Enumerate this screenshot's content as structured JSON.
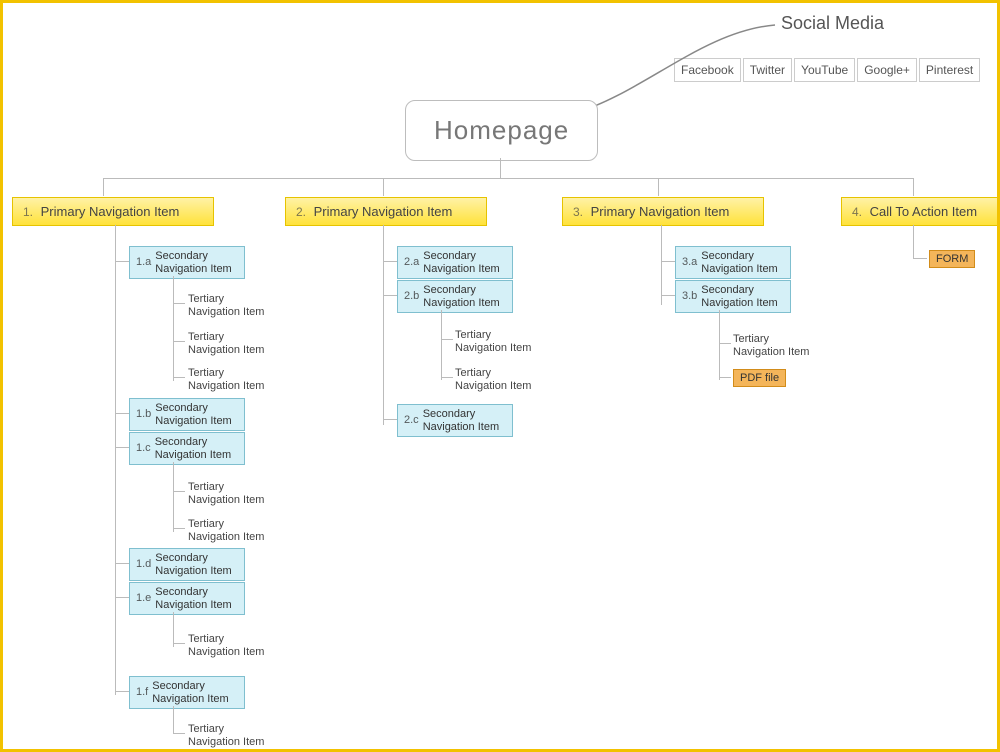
{
  "root": {
    "title": "Homepage"
  },
  "social": {
    "label": "Social Media",
    "items": [
      "Facebook",
      "Twitter",
      "YouTube",
      "Google+",
      "Pinterest"
    ]
  },
  "columns": [
    {
      "num": "1.",
      "label": "Primary Navigation Item",
      "children": [
        {
          "num": "1.a",
          "label": "Secondary\nNavigation Item",
          "children": [
            {
              "label": "Tertiary\nNavigation Item"
            },
            {
              "label": "Tertiary\nNavigation Item"
            },
            {
              "label": "Tertiary\nNavigation Item"
            }
          ]
        },
        {
          "num": "1.b",
          "label": "Secondary\nNavigation Item",
          "children": []
        },
        {
          "num": "1.c",
          "label": "Secondary\nNavigation Item",
          "children": [
            {
              "label": "Tertiary\nNavigation Item"
            },
            {
              "label": "Tertiary\nNavigation Item"
            }
          ]
        },
        {
          "num": "1.d",
          "label": "Secondary\nNavigation Item",
          "children": []
        },
        {
          "num": "1.e",
          "label": "Secondary\nNavigation Item",
          "children": [
            {
              "label": "Tertiary\nNavigation Item"
            }
          ]
        },
        {
          "num": "1.f",
          "label": "Secondary\nNavigation Item",
          "children": [
            {
              "label": "Tertiary\nNavigation Item"
            }
          ]
        }
      ]
    },
    {
      "num": "2.",
      "label": "Primary Navigation Item",
      "children": [
        {
          "num": "2.a",
          "label": "Secondary\nNavigation Item",
          "children": []
        },
        {
          "num": "2.b",
          "label": "Secondary\nNavigation Item",
          "children": [
            {
              "label": "Tertiary\nNavigation Item"
            },
            {
              "label": "Tertiary\nNavigation Item"
            }
          ]
        },
        {
          "num": "2.c",
          "label": "Secondary\nNavigation Item",
          "children": []
        }
      ]
    },
    {
      "num": "3.",
      "label": "Primary Navigation Item",
      "children": [
        {
          "num": "3.a",
          "label": "Secondary\nNavigation Item",
          "children": []
        },
        {
          "num": "3.b",
          "label": "Secondary\nNavigation Item",
          "children": [
            {
              "label": "Tertiary\nNavigation Item"
            },
            {
              "label": "PDF file",
              "type": "orange"
            }
          ]
        }
      ]
    },
    {
      "num": "4.",
      "label": "Call To Action Item",
      "children": [
        {
          "label": "FORM",
          "type": "orange"
        }
      ]
    }
  ]
}
